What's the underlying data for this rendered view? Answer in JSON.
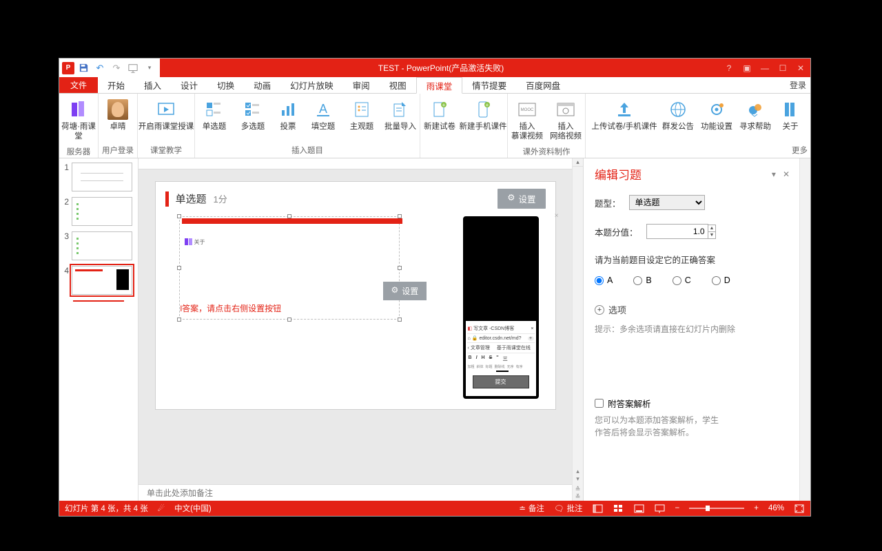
{
  "title": "TEST -  PowerPoint(产品激活失败)",
  "login": "登录",
  "tabs": {
    "file": "文件",
    "items": [
      "开始",
      "插入",
      "设计",
      "切换",
      "动画",
      "幻灯片放映",
      "审阅",
      "视图",
      "雨课堂",
      "情节提要",
      "百度网盘"
    ],
    "active_index": 8
  },
  "ribbon": {
    "groups": [
      {
        "label": "服务器",
        "btns": [
          {
            "key": "hetang",
            "label": "荷塘·雨课堂"
          }
        ]
      },
      {
        "label": "用户登录",
        "btns": [
          {
            "key": "zhuoqing",
            "label": "卓晴"
          }
        ]
      },
      {
        "label": "课堂教学",
        "btns": [
          {
            "key": "openclass",
            "label": "开启雨课堂授课"
          }
        ]
      },
      {
        "label": "插入题目",
        "btns": [
          {
            "key": "single",
            "label": "单选题"
          },
          {
            "key": "multi",
            "label": "多选题"
          },
          {
            "key": "vote",
            "label": "投票"
          },
          {
            "key": "fill",
            "label": "填空题"
          },
          {
            "key": "subj",
            "label": "主观题"
          },
          {
            "key": "bulk",
            "label": "批量导入"
          }
        ]
      },
      {
        "label": "",
        "btns": [
          {
            "key": "newexam",
            "label": "新建试卷"
          },
          {
            "key": "newmobile",
            "label": "新建手机课件"
          }
        ]
      },
      {
        "label": "课外资料制作",
        "btns": [
          {
            "key": "insertmooc",
            "label": "插入\n慕课视频"
          },
          {
            "key": "insertweb",
            "label": "插入\n网络视频"
          }
        ]
      },
      {
        "label": "",
        "btns": [
          {
            "key": "upload",
            "label": "上传试卷/手机课件"
          },
          {
            "key": "groupmsg",
            "label": "群发公告"
          },
          {
            "key": "settings",
            "label": "功能设置"
          },
          {
            "key": "help",
            "label": "寻求帮助"
          },
          {
            "key": "about",
            "label": "关于"
          }
        ]
      }
    ],
    "more": "更多"
  },
  "slide": {
    "q_title": "单选题",
    "q_score": "1分",
    "q_settings": "设置",
    "hint": "l答案，请点击右侧设置按钮",
    "phone": {
      "line1": "写文章 -CSDN博客",
      "url": "editor.csdn.net/md?",
      "nav_back": "文章管理",
      "nav_title": "基于雨课堂在线",
      "toolbar": [
        "B",
        "I",
        "H",
        "S",
        "''",
        "三"
      ],
      "toolbar_sub": [
        "加粗",
        "斜体",
        "标题",
        "删除线",
        "无序",
        "有序"
      ],
      "submit": "提交"
    }
  },
  "notes_placeholder": "单击此处添加备注",
  "panel": {
    "title": "编辑习题",
    "type_label": "题型：",
    "type_value": "单选题",
    "score_label": "本题分值：",
    "score_value": "1.0",
    "answer_label": "请为当前题目设定它的正确答案",
    "options": [
      "A",
      "B",
      "C",
      "D"
    ],
    "selected_option": "A",
    "add_option": "选项",
    "tip": "提示：多余选项请直接在幻灯片内删除",
    "attach_label": "附答案解析",
    "attach_note1": "您可以为本题添加答案解析，学生",
    "attach_note2": "作答后将会显示答案解析。"
  },
  "statusbar": {
    "slide_info": "幻灯片 第 4 张，共 4 张",
    "lang": "中文(中国)",
    "notes": "备注",
    "comments": "批注",
    "zoom": "46%"
  },
  "thumbs": [
    1,
    2,
    3,
    4
  ]
}
